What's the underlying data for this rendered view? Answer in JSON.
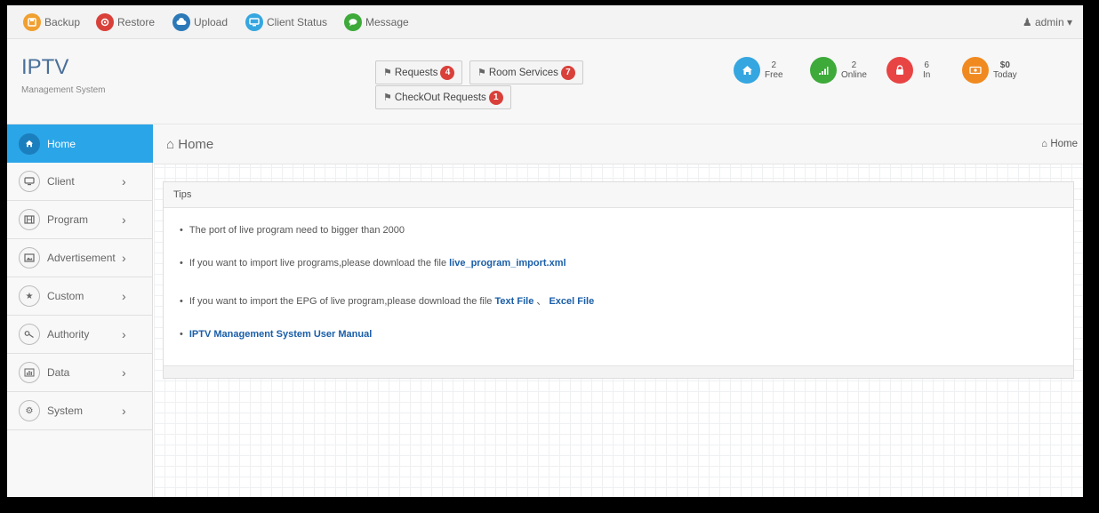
{
  "toolbar": {
    "items": [
      {
        "label": "Backup",
        "icon": "backup-icon",
        "color": "#f0a030",
        "glyph": "⬛"
      },
      {
        "label": "Restore",
        "icon": "restore-icon",
        "color": "#d9403a",
        "glyph": "●"
      },
      {
        "label": "Upload",
        "icon": "upload-icon",
        "color": "#2c79b8",
        "glyph": "☁"
      },
      {
        "label": "Client Status",
        "icon": "monitor-icon",
        "color": "#35a6e0",
        "glyph": "▭"
      },
      {
        "label": "Message",
        "icon": "chat-icon",
        "color": "#3daa3a",
        "glyph": "●"
      }
    ],
    "user": "admin"
  },
  "brand": {
    "title": "IPTV",
    "subtitle": "Management System"
  },
  "requests": {
    "requests_label": "Requests",
    "requests_count": "4",
    "room_label": "Room Services",
    "room_count": "7",
    "checkout_label": "CheckOut Requests",
    "checkout_count": "1"
  },
  "stats": [
    {
      "value": "2",
      "label": "Free",
      "color": "#35a6e0",
      "icon": "home-icon"
    },
    {
      "value": "2",
      "label": "Online",
      "color": "#3daa3a",
      "icon": "signal-icon"
    },
    {
      "value": "6",
      "label": "In",
      "color": "#e84444",
      "icon": "lock-icon"
    },
    {
      "value": "$0",
      "label": "Today",
      "color": "#f08a20",
      "icon": "money-icon"
    }
  ],
  "sidebar": {
    "items": [
      {
        "label": "Home",
        "icon": "home-icon",
        "active": true
      },
      {
        "label": "Client",
        "icon": "monitor-icon"
      },
      {
        "label": "Program",
        "icon": "film-icon"
      },
      {
        "label": "Advertisement",
        "icon": "picture-icon"
      },
      {
        "label": "Custom",
        "icon": "star-icon"
      },
      {
        "label": "Authority",
        "icon": "key-icon"
      },
      {
        "label": "Data",
        "icon": "bar-chart-icon"
      },
      {
        "label": "System",
        "icon": "gear-icon"
      }
    ]
  },
  "main": {
    "title": "Home",
    "breadcrumb": "Home",
    "panel_title": "Tips",
    "tip1": "The port of live program need to bigger than 2000",
    "tip2_text": "If you want to import live programs,please download the file ",
    "tip2_link": "live_program_import.xml",
    "tip3_text": "If you want to import the EPG of live program,please download the file ",
    "tip3_link1": "Text File",
    "tip3_sep": " 、 ",
    "tip3_link2": "Excel File",
    "tip4_link": "IPTV Management System User Manual"
  },
  "colors": {
    "accent": "#2aa5e8",
    "badge": "#d9403a",
    "link": "#1a5ea8"
  }
}
